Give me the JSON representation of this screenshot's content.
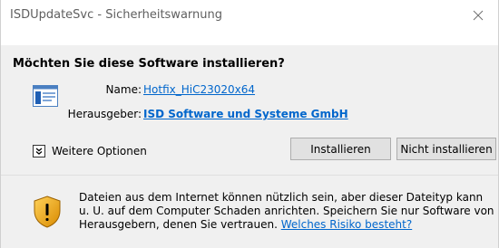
{
  "window": {
    "title": "ISDUpdateSvc - Sicherheitswarnung",
    "close_glyph": "✕"
  },
  "main": {
    "question": "Möchten Sie diese Software installieren?",
    "name_label": "Name:",
    "name_value": "Hotfix_HiC23020x64",
    "publisher_label": "Herausgeber:",
    "publisher_value": "ISD Software und Systeme GmbH",
    "more_options_label": "Weitere Optionen",
    "more_options_glyph": "»"
  },
  "buttons": {
    "install": "Installieren",
    "dont_install": "Nicht installieren"
  },
  "footer": {
    "warning_text": "Dateien aus dem Internet können nützlich sein, aber dieser Dateityp kann u. U. auf dem Computer Schaden anrichten. Speichern Sie nur Software von Herausgebern, denen Sie vertrauen.",
    "risk_link": "Welches Risiko besteht?"
  },
  "colors": {
    "link": "#0066cc",
    "panel": "#f0f0f0",
    "button": "#e1e1e1",
    "shield_gold": "#e8a317"
  },
  "icons": {
    "software": "installer-window-icon",
    "shield": "security-shield-icon",
    "close": "close-icon",
    "expand": "chevron-double-down-icon"
  }
}
